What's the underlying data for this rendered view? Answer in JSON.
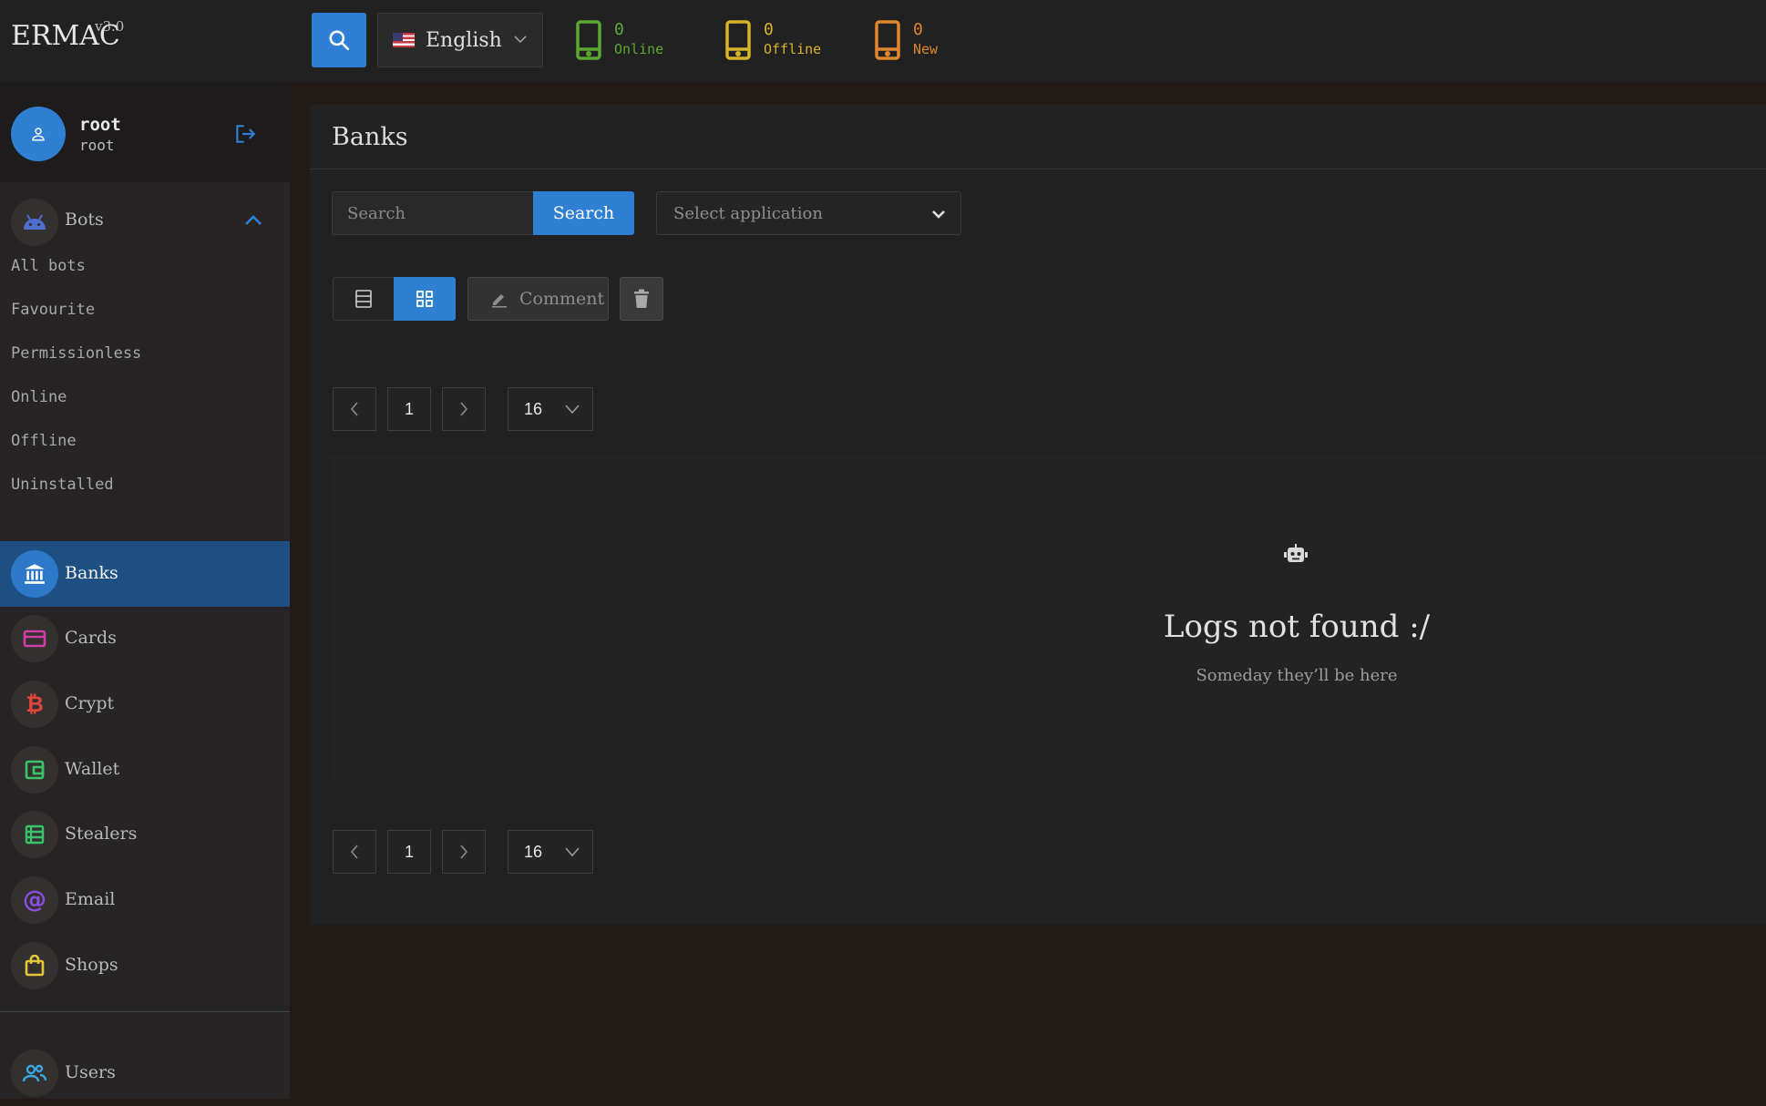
{
  "app": {
    "name": "ERMAC",
    "version": "v3.0"
  },
  "topbar": {
    "language": "English",
    "stats": [
      {
        "count": "0",
        "label": "Online",
        "color": "#5aa832",
        "icon": "phone-icon"
      },
      {
        "count": "0",
        "label": "Offline",
        "color": "#d8b42b",
        "icon": "phone-icon"
      },
      {
        "count": "0",
        "label": "New",
        "color": "#e0862c",
        "icon": "phone-icon"
      }
    ]
  },
  "user": {
    "name": "root",
    "role": "root"
  },
  "sidebar": {
    "bots": {
      "label": "Bots",
      "items": [
        "All bots",
        "Favourite",
        "Permissionless",
        "Online",
        "Offline",
        "Uninstalled"
      ]
    },
    "nav": [
      {
        "label": "Banks",
        "icon": "bank-icon",
        "color": "#ffffff",
        "active": true
      },
      {
        "label": "Cards",
        "icon": "card-icon",
        "color": "#d23ea8"
      },
      {
        "label": "Crypt",
        "icon": "bitcoin-icon",
        "color": "#e0443a"
      },
      {
        "label": "Wallet",
        "icon": "wallet-icon",
        "color": "#39c46a"
      },
      {
        "label": "Stealers",
        "icon": "table-icon",
        "color": "#39c46a"
      },
      {
        "label": "Email",
        "icon": "at-icon",
        "color": "#8a4fe0"
      },
      {
        "label": "Shops",
        "icon": "bag-icon",
        "color": "#e3c63a"
      },
      {
        "label": "Users",
        "icon": "users-icon",
        "color": "#3aa6e0"
      }
    ]
  },
  "main": {
    "title": "Banks",
    "search": {
      "placeholder": "Search",
      "button": "Search"
    },
    "app_select": {
      "placeholder": "Select application"
    },
    "comment_button": "Comment",
    "pagination": {
      "page": "1",
      "per_page": "16"
    },
    "empty": {
      "title": "Logs not found :/",
      "subtitle": "Someday they’ll be here"
    }
  },
  "colors": {
    "accent": "#2f7fd2",
    "active_nav": "#1e4f82"
  }
}
